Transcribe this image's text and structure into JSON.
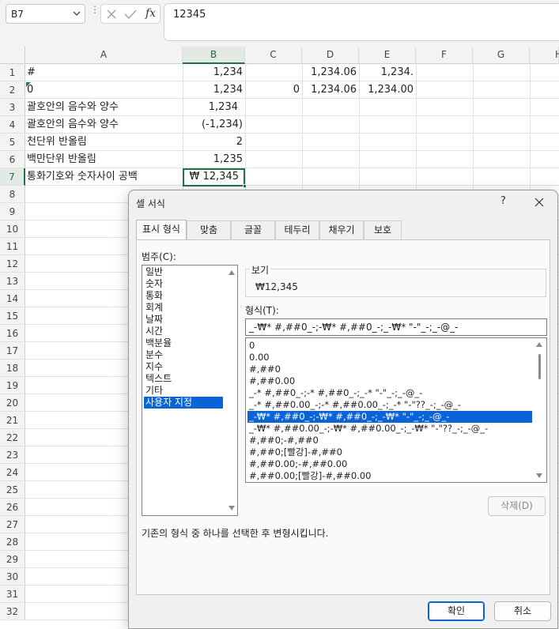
{
  "formula_bar": {
    "name_box": "B7",
    "formula_value": "12345",
    "fx_label": "fx"
  },
  "columns": [
    "A",
    "B",
    "C",
    "D",
    "E",
    "F",
    "G",
    "H"
  ],
  "rows": [
    "1",
    "2",
    "3",
    "4",
    "5",
    "6",
    "7",
    "8",
    "9",
    "10",
    "11",
    "12",
    "13",
    "14",
    "15",
    "16",
    "17",
    "18",
    "19",
    "20",
    "21",
    "22",
    "23",
    "24",
    "25",
    "26",
    "27",
    "28",
    "29",
    "30",
    "31",
    "32"
  ],
  "cells": {
    "A1": "#",
    "B1": "1,234",
    "D1": "1,234.06",
    "E1": "1,234.",
    "A2": "0",
    "B2": "1,234",
    "C2": "0",
    "D2": "1,234.06",
    "E2": "1,234.00",
    "A3": "괄호안의 음수와 양수",
    "B3": "1,234",
    "A4": "괄호안의 음수와 양수",
    "B4": "(-1,234)",
    "A5": "천단위 반올림",
    "B5": "2",
    "A6": "백만단위 반올림",
    "B6": "1,235",
    "A7": "통화기호와 숫자사이 공백",
    "B7": "₩  12,345"
  },
  "dialog": {
    "title": "셀 서식",
    "help": "?",
    "tabs": [
      "표시 형식",
      "맞춤",
      "글꼴",
      "테두리",
      "채우기",
      "보호"
    ],
    "category_label": "범주(C):",
    "categories": [
      "일반",
      "숫자",
      "통화",
      "회계",
      "날짜",
      "시간",
      "백분율",
      "분수",
      "지수",
      "텍스트",
      "기타",
      "사용자 지정"
    ],
    "selected_category": 11,
    "preview_label": "보기",
    "preview_value": "₩12,345",
    "format_label": "형식(T):",
    "format_input": "_-₩* #,##0_-;-₩* #,##0_-;_-₩* \"-\"_-;_-@_-",
    "format_list": [
      "0",
      "0.00",
      "#,##0",
      "#,##0.00",
      "_-* #,##0_-;-* #,##0_-;_-* \"-\"_-;_-@_-",
      "_-* #,##0.00_-;-* #,##0.00_-;_-* \"-\"??_-;_-@_-",
      "_-₩* #,##0_-;-₩* #,##0_-;_-₩* \"-\"_-;_-@_-",
      "_-₩* #,##0.00_-;-₩* #,##0.00_-;_-₩* \"-\"??_-;_-@_-",
      "#,##0;-#,##0",
      "#,##0;[빨강]-#,##0",
      "#,##0.00;-#,##0.00",
      "#,##0.00;[빨강]-#,##0.00"
    ],
    "selected_format": 6,
    "delete_button": "삭제(D)",
    "hint": "기존의 형식 중 하나를 선택한 후 변형시킵니다.",
    "ok_button": "확인",
    "cancel_button": "취소"
  },
  "colors": {
    "accent_green": "#217346",
    "selection_blue": "#0a64d8"
  }
}
